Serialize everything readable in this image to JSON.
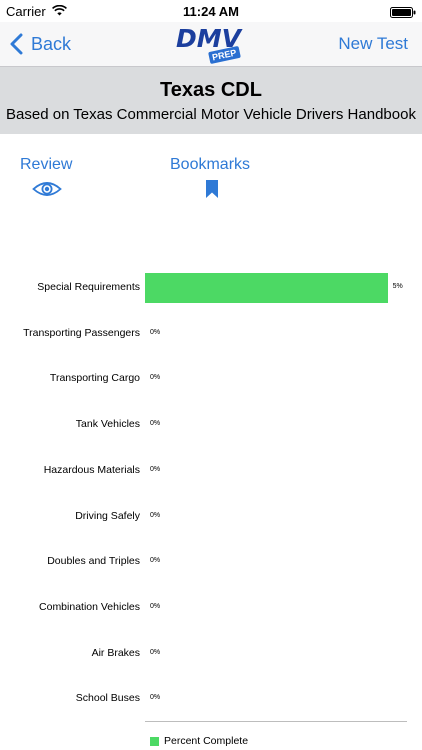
{
  "status_bar": {
    "carrier": "Carrier",
    "time": "11:24 AM",
    "wifi_icon": "wifi-icon",
    "battery_icon": "battery-icon"
  },
  "nav": {
    "back_label": "Back",
    "logo_text": "DMV",
    "logo_badge": "PREP",
    "new_test_label": "New Test"
  },
  "header": {
    "title": "Texas CDL",
    "subtitle": "Based on Texas Commercial Motor Vehicle Drivers Handbook"
  },
  "tabs": [
    {
      "label": "Review",
      "icon": "eye-icon"
    },
    {
      "label": "Bookmarks",
      "icon": "bookmark-icon"
    }
  ],
  "colors": {
    "accent": "#2f7ad6",
    "bar": "#4cd964",
    "header_bg": "#dadcde"
  },
  "chart_data": {
    "type": "bar",
    "orientation": "horizontal",
    "categories": [
      "Special Requirements",
      "Transporting Passengers",
      "Transporting Cargo",
      "Tank Vehicles",
      "Hazardous Materials",
      "Driving Safely",
      "Doubles and Triples",
      "Combination Vehicles",
      "Air Brakes",
      "School Buses"
    ],
    "value_labels": [
      "5%",
      "0%",
      "0%",
      "0%",
      "0%",
      "0%",
      "0%",
      "0%",
      "0%",
      "0%"
    ],
    "series": [
      {
        "name": "Percent Complete",
        "values": [
          5,
          0,
          0,
          0,
          0,
          0,
          0,
          0,
          0,
          0
        ]
      }
    ],
    "xlim": [
      0,
      5.4
    ],
    "grid": false,
    "legend": "bottom"
  }
}
